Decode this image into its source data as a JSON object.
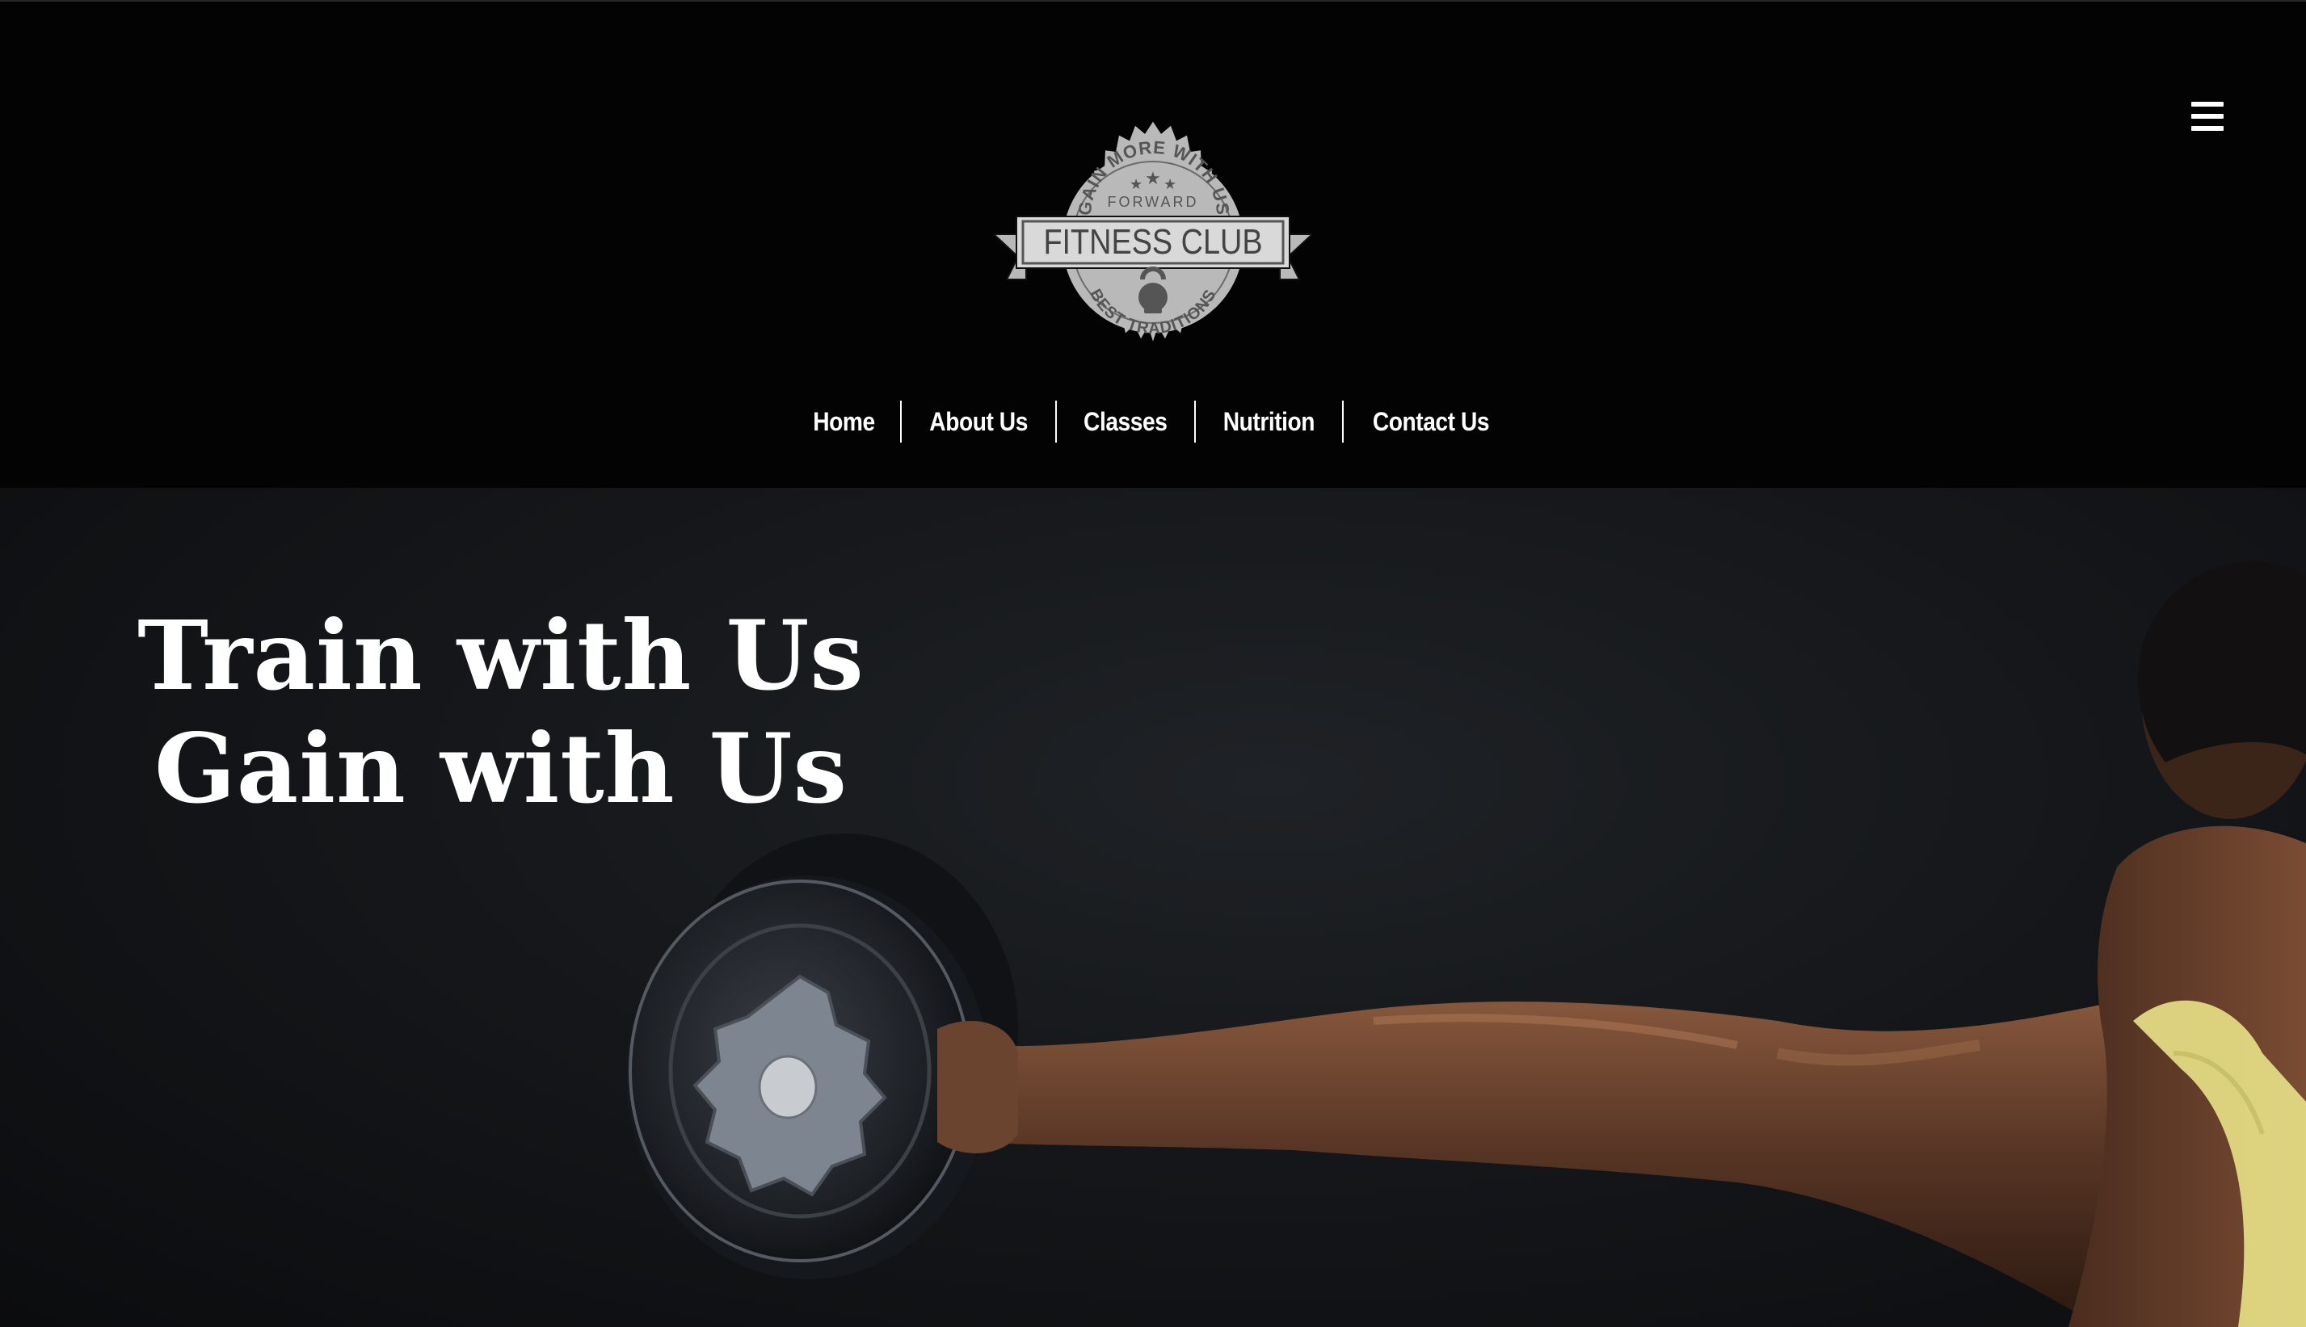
{
  "header": {
    "logo": {
      "top_arc": "GAIN MORE WITH US",
      "subtitle": "FORWARD",
      "ribbon": "FITNESS CLUB",
      "bottom_arc": "BEST TRADITIONS",
      "icon": "kettlebell-icon"
    },
    "menu_icon": "hamburger-menu-icon"
  },
  "nav": {
    "items": [
      {
        "label": "Home"
      },
      {
        "label": "About Us"
      },
      {
        "label": "Classes"
      },
      {
        "label": "Nutrition"
      },
      {
        "label": "Contact Us"
      }
    ]
  },
  "hero": {
    "title_line1": "Train with Us",
    "title_line2": "Gain with Us"
  },
  "colors": {
    "header_bg": "#030303",
    "hero_bg": "#15171a",
    "text": "#ffffff",
    "logo_gray": "#b9b9b9",
    "shirt_yellow": "#e6de86"
  }
}
